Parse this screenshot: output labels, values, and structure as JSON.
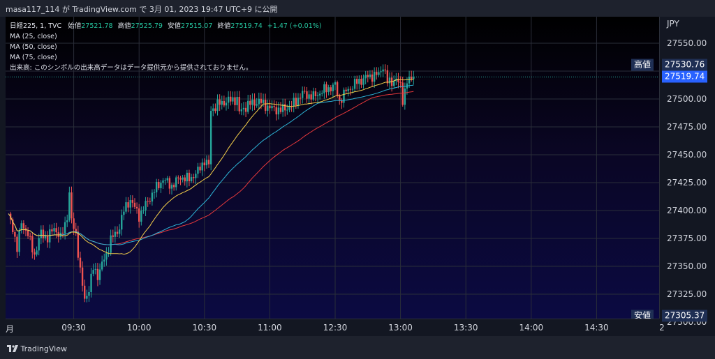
{
  "header": {
    "caption": "masa117_114 が TradingView.com で 3月 01, 2023 19:47 UTC+9 に公開"
  },
  "legend": {
    "symbol": "日経225, 1, TVC",
    "ohlc": [
      {
        "label": "始値",
        "value": "27521.78"
      },
      {
        "label": "高値",
        "value": "27525.79"
      },
      {
        "label": "安値",
        "value": "27515.07"
      },
      {
        "label": "終値",
        "value": "27519.74"
      }
    ],
    "change": "+1.47 (+0.01%)",
    "ma_lines": [
      "MA (25, close)",
      "MA (50, close)",
      "MA (75, close)"
    ],
    "volume_note": "出来高: このシンボルの出来高データはデータ提供元から提供されておりません。"
  },
  "colors": {
    "up": "#26a69a",
    "down": "#ef5350",
    "ma25": "#f5d04a",
    "ma50": "#2db6d8",
    "ma75": "#e5383b",
    "tag_bg": "#1f2f54",
    "current_tag_bg": "#2962ff"
  },
  "footer": {
    "brand": "TradingView"
  },
  "chart_data": {
    "type": "candlestick",
    "currency": "JPY",
    "ylim": [
      27305,
      27560
    ],
    "y_ticks": [
      27300,
      27325,
      27350,
      27375,
      27400,
      27425,
      27450,
      27475,
      27500,
      27525,
      27550
    ],
    "y_tick_labels": [
      "27300.00",
      "27325.00",
      "27350.00",
      "27375.00",
      "27400.00",
      "27425.00",
      "27450.00",
      "27475.00",
      "27500.00",
      "27525.00",
      "27550.00"
    ],
    "x_labels": [
      {
        "text": "月",
        "minute": 0
      },
      {
        "text": "09:30",
        "minute": 30
      },
      {
        "text": "10:00",
        "minute": 60
      },
      {
        "text": "10:30",
        "minute": 90
      },
      {
        "text": "11:00",
        "minute": 120
      },
      {
        "text": "12:30",
        "minute": 150
      },
      {
        "text": "13:00",
        "minute": 180
      },
      {
        "text": "13:30",
        "minute": 210
      },
      {
        "text": "14:00",
        "minute": 240
      },
      {
        "text": "14:30",
        "minute": 270
      },
      {
        "text": "2",
        "minute": 300
      }
    ],
    "high_tag": {
      "label": "高値",
      "value": 27530.76,
      "text": "27530.76"
    },
    "low_tag": {
      "label": "安値",
      "value": 27305.37,
      "text": "27305.37"
    },
    "last": {
      "value": 27519.74,
      "text": "27519.74"
    },
    "close_anchors": [
      [
        0,
        27395
      ],
      [
        2,
        27385
      ],
      [
        4,
        27365
      ],
      [
        6,
        27390
      ],
      [
        9,
        27378
      ],
      [
        12,
        27360
      ],
      [
        15,
        27380
      ],
      [
        18,
        27375
      ],
      [
        21,
        27385
      ],
      [
        24,
        27375
      ],
      [
        27,
        27395
      ],
      [
        28,
        27415
      ],
      [
        29,
        27390
      ],
      [
        31,
        27380
      ],
      [
        33,
        27345
      ],
      [
        35,
        27320
      ],
      [
        37,
        27330
      ],
      [
        39,
        27348
      ],
      [
        41,
        27342
      ],
      [
        43,
        27352
      ],
      [
        45,
        27360
      ],
      [
        47,
        27375
      ],
      [
        50,
        27380
      ],
      [
        53,
        27400
      ],
      [
        56,
        27410
      ],
      [
        60,
        27395
      ],
      [
        63,
        27405
      ],
      [
        67,
        27418
      ],
      [
        71,
        27428
      ],
      [
        75,
        27422
      ],
      [
        79,
        27430
      ],
      [
        83,
        27428
      ],
      [
        87,
        27435
      ],
      [
        90,
        27445
      ],
      [
        92,
        27440
      ],
      [
        93,
        27490
      ],
      [
        96,
        27495
      ],
      [
        100,
        27498
      ],
      [
        105,
        27500
      ],
      [
        106,
        27488
      ],
      [
        110,
        27495
      ],
      [
        115,
        27498
      ],
      [
        120,
        27492
      ],
      [
        125,
        27490
      ],
      [
        130,
        27494
      ],
      [
        135,
        27505
      ],
      [
        140,
        27502
      ],
      [
        145,
        27508
      ],
      [
        150,
        27512
      ],
      [
        152,
        27498
      ],
      [
        155,
        27507
      ],
      [
        160,
        27515
      ],
      [
        165,
        27520
      ],
      [
        170,
        27522
      ],
      [
        172,
        27530
      ],
      [
        174,
        27515
      ],
      [
        178,
        27517
      ],
      [
        180,
        27512
      ],
      [
        181,
        27500
      ],
      [
        183,
        27515
      ],
      [
        186,
        27519.74
      ]
    ]
  }
}
